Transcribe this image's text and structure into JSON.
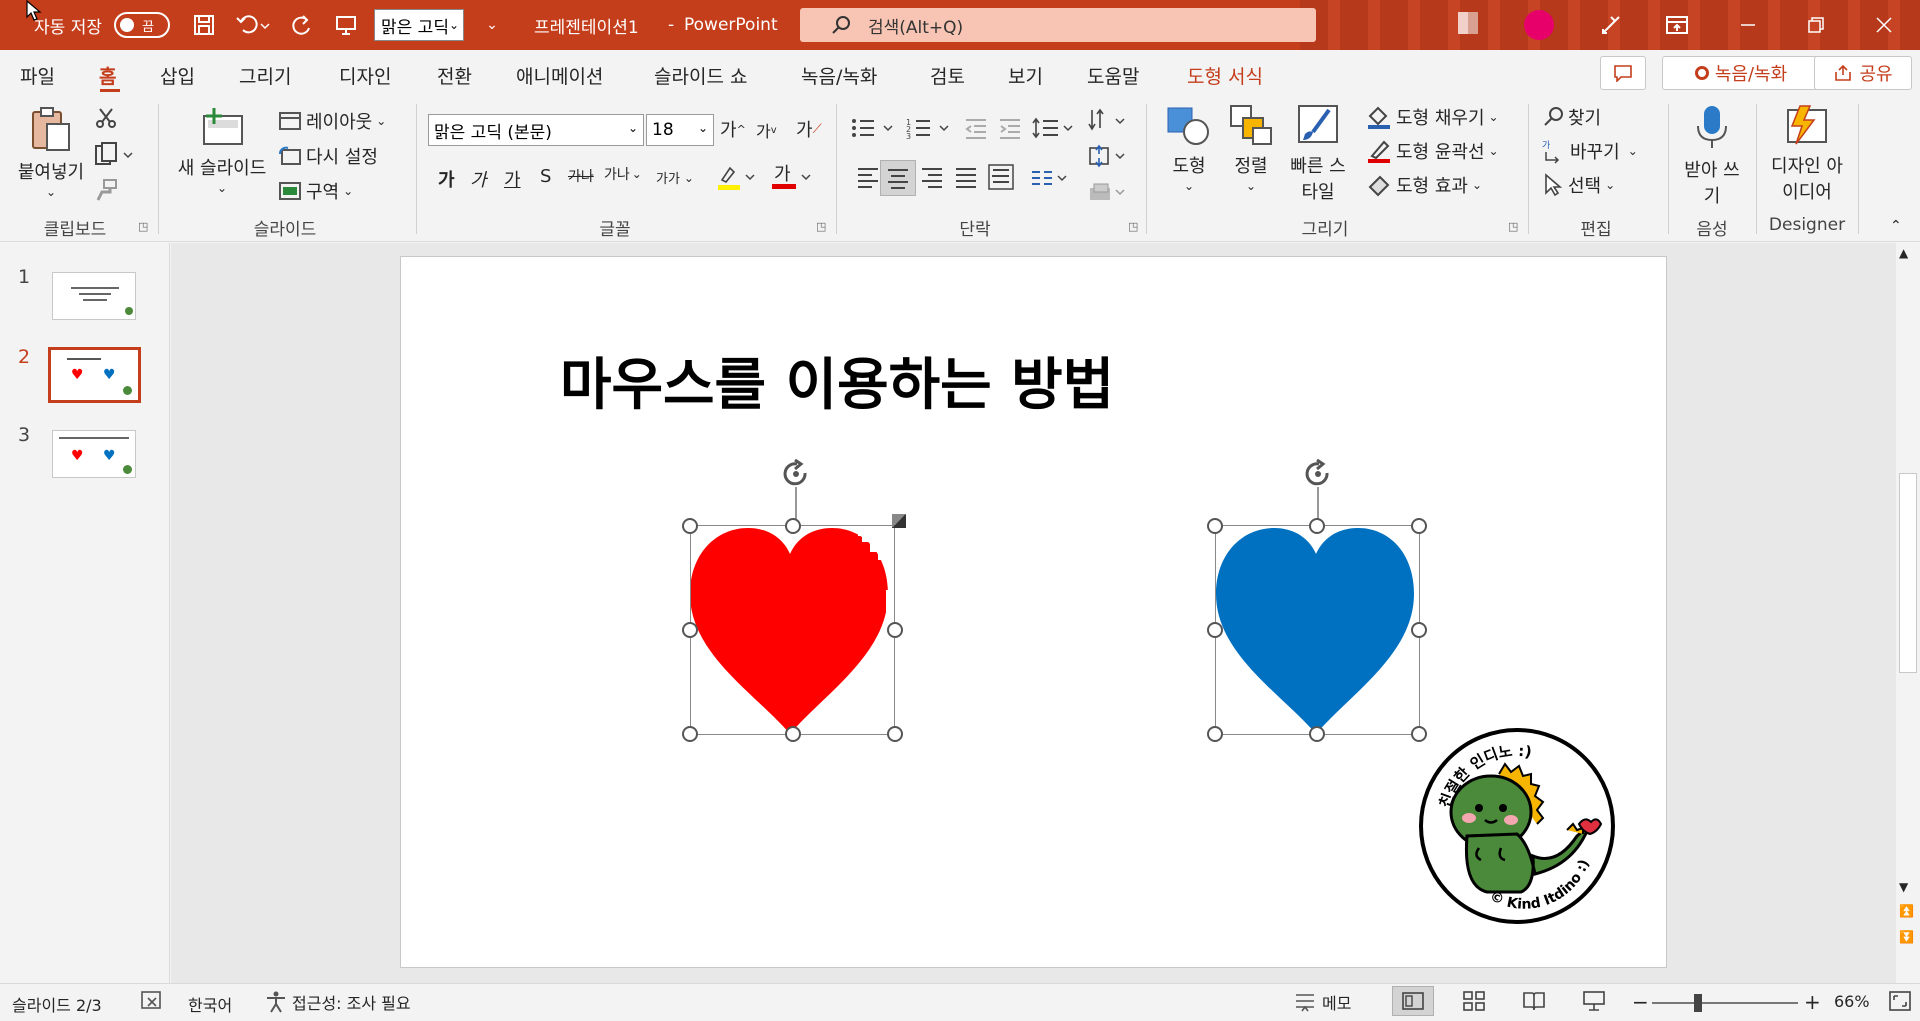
{
  "titlebar": {
    "autosave_label": "자동 저장",
    "autosave_state": "끔",
    "font_quick": "맑은 고딕",
    "doc_name": "프레젠테이션1",
    "separator": "-",
    "app_name": "PowerPoint",
    "search_placeholder": "검색(Alt+Q)",
    "bg_color": "#c43e1c"
  },
  "menu": {
    "tabs": [
      "파일",
      "홈",
      "삽입",
      "그리기",
      "디자인",
      "전환",
      "애니메이션",
      "슬라이드 쇼",
      "녹음/녹화",
      "검토",
      "보기",
      "도움말",
      "도형 서식"
    ],
    "active_tab": "홈",
    "record_btn": "녹음/녹화",
    "share_btn": "공유"
  },
  "ribbon": {
    "clipboard": {
      "paste": "붙여넣기",
      "label": "클립보드"
    },
    "slides": {
      "new_slide": "새 슬라이드",
      "layout": "레이아웃",
      "reset": "다시 설정",
      "section": "구역",
      "label": "슬라이드"
    },
    "font": {
      "family": "맑은 고딕 (본문)",
      "size": "18",
      "bold": "가",
      "italic": "가",
      "underline": "가",
      "shadow": "S",
      "strike": "가나",
      "spacing": "가나",
      "case": "가가",
      "grow": "가",
      "shrink": "가",
      "clear": "가",
      "label": "글꼴"
    },
    "paragraph": {
      "label": "단락"
    },
    "drawing": {
      "shapes": "도형",
      "arrange": "정렬",
      "quick_styles": "빠른 스타일",
      "fill": "도형 채우기",
      "outline": "도형 윤곽선",
      "effects": "도형 효과",
      "label": "그리기"
    },
    "editing": {
      "find": "찾기",
      "replace": "바꾸기",
      "select": "선택",
      "label": "편집"
    },
    "voice": {
      "dictate": "받아 쓰기",
      "label": "음성"
    },
    "designer": {
      "ideas": "디자인 아이디어",
      "label": "Designer"
    }
  },
  "thumbnails": [
    {
      "num": "1",
      "selected": false
    },
    {
      "num": "2",
      "selected": true
    },
    {
      "num": "3",
      "selected": false
    }
  ],
  "slide": {
    "title": "마우스를 이용하는 방법",
    "heart_left_color": "#ff0000",
    "heart_right_color": "#0070c0",
    "sticker_top_text": "친절한 인디노 :)",
    "sticker_bottom_text": "© Kind Itdino :)"
  },
  "status": {
    "slide_pos": "슬라이드 2/3",
    "language": "한국어",
    "accessibility": "접근성: 조사 필요",
    "notes": "메모",
    "zoom": "66%"
  }
}
